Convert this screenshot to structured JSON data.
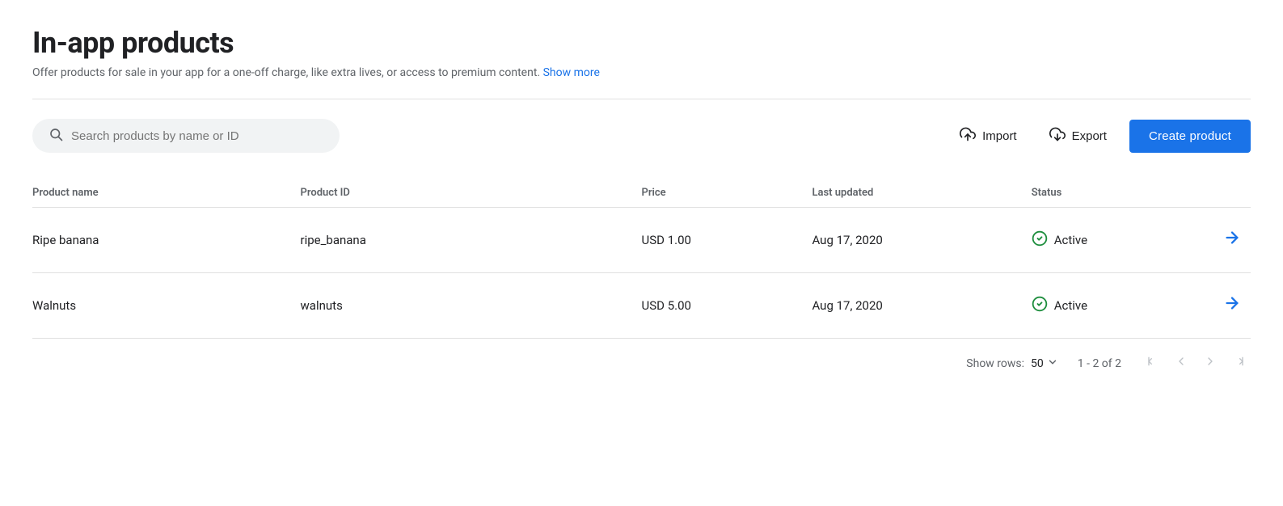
{
  "page": {
    "title": "In-app products",
    "description": "Offer products for sale in your app for a one-off charge, like extra lives, or access to premium content.",
    "show_more_label": "Show more"
  },
  "toolbar": {
    "search_placeholder": "Search products by name or ID",
    "import_label": "Import",
    "export_label": "Export",
    "create_label": "Create product"
  },
  "table": {
    "columns": [
      {
        "id": "product_name",
        "label": "Product name"
      },
      {
        "id": "product_id",
        "label": "Product ID"
      },
      {
        "id": "price",
        "label": "Price"
      },
      {
        "id": "last_updated",
        "label": "Last updated"
      },
      {
        "id": "status",
        "label": "Status"
      }
    ],
    "rows": [
      {
        "product_name": "Ripe banana",
        "product_id": "ripe_banana",
        "price": "USD 1.00",
        "last_updated": "Aug 17, 2020",
        "status": "Active"
      },
      {
        "product_name": "Walnuts",
        "product_id": "walnuts",
        "price": "USD 5.00",
        "last_updated": "Aug 17, 2020",
        "status": "Active"
      }
    ]
  },
  "pagination": {
    "show_rows_label": "Show rows:",
    "rows_per_page": "50",
    "page_info": "1 - 2 of 2"
  },
  "colors": {
    "accent": "#1a73e8",
    "active_green": "#1e8e3e"
  }
}
